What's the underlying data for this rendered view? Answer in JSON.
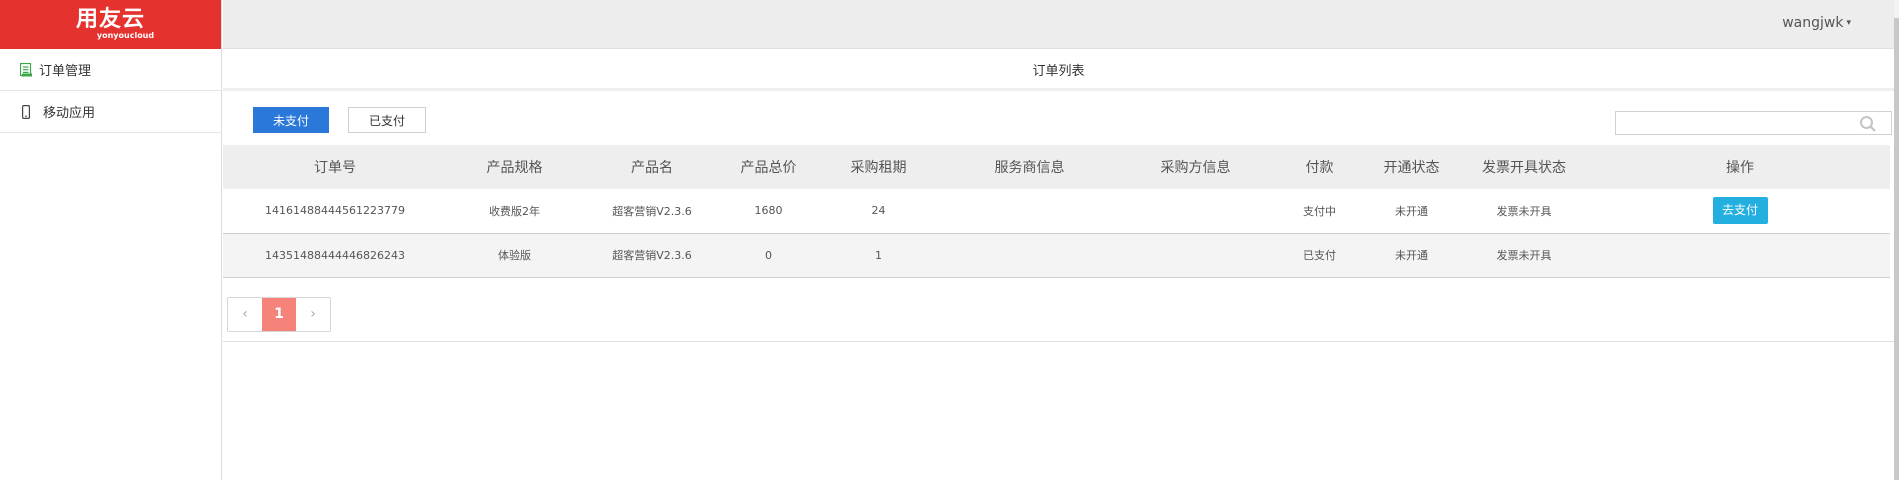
{
  "brand": {
    "name": "用友云",
    "sub": "yonyoucloud",
    "color": "#e6322f"
  },
  "header": {
    "username": "wangjwk",
    "caret": "▾"
  },
  "sidebar": {
    "items": [
      {
        "label": "订单管理",
        "icon": "order-list-icon"
      },
      {
        "label": "移动应用",
        "icon": "mobile-phone-icon"
      }
    ]
  },
  "page": {
    "title": "订单列表"
  },
  "filter": {
    "tabs": [
      {
        "label": "未支付",
        "active": true
      },
      {
        "label": "已支付",
        "active": false
      }
    ],
    "search": {
      "placeholder": "",
      "icon": "search-icon"
    }
  },
  "table": {
    "columns": [
      "订单号",
      "产品规格",
      "产品名",
      "产品总价",
      "采购租期",
      "服务商信息",
      "采购方信息",
      "付款",
      "开通状态",
      "发票开具状态",
      "操作"
    ],
    "rows": [
      {
        "order_no": "1416148844456122377​9",
        "spec": "收费版2年",
        "product": "超客营销V2.3.6",
        "total": "1680",
        "term": "24",
        "vendor": "",
        "buyer": "",
        "payment": "支付中",
        "activation": "未开通",
        "invoice": "发票未开具",
        "action": "去支付"
      },
      {
        "order_no": "14351488444446826243",
        "spec": "体验版",
        "product": "超客营销V2.3.6",
        "total": "0",
        "term": "1",
        "vendor": "",
        "buyer": "",
        "payment": "已支付",
        "activation": "未开通",
        "invoice": "发票未开具",
        "action": ""
      }
    ]
  },
  "pagination": {
    "prev": "‹",
    "current": "1",
    "next": "›"
  },
  "colors": {
    "primary_button": "#2a79da",
    "action_button": "#23b0e0",
    "page_current": "#f6837a",
    "sidebar_icon_green": "#3aa64a"
  }
}
